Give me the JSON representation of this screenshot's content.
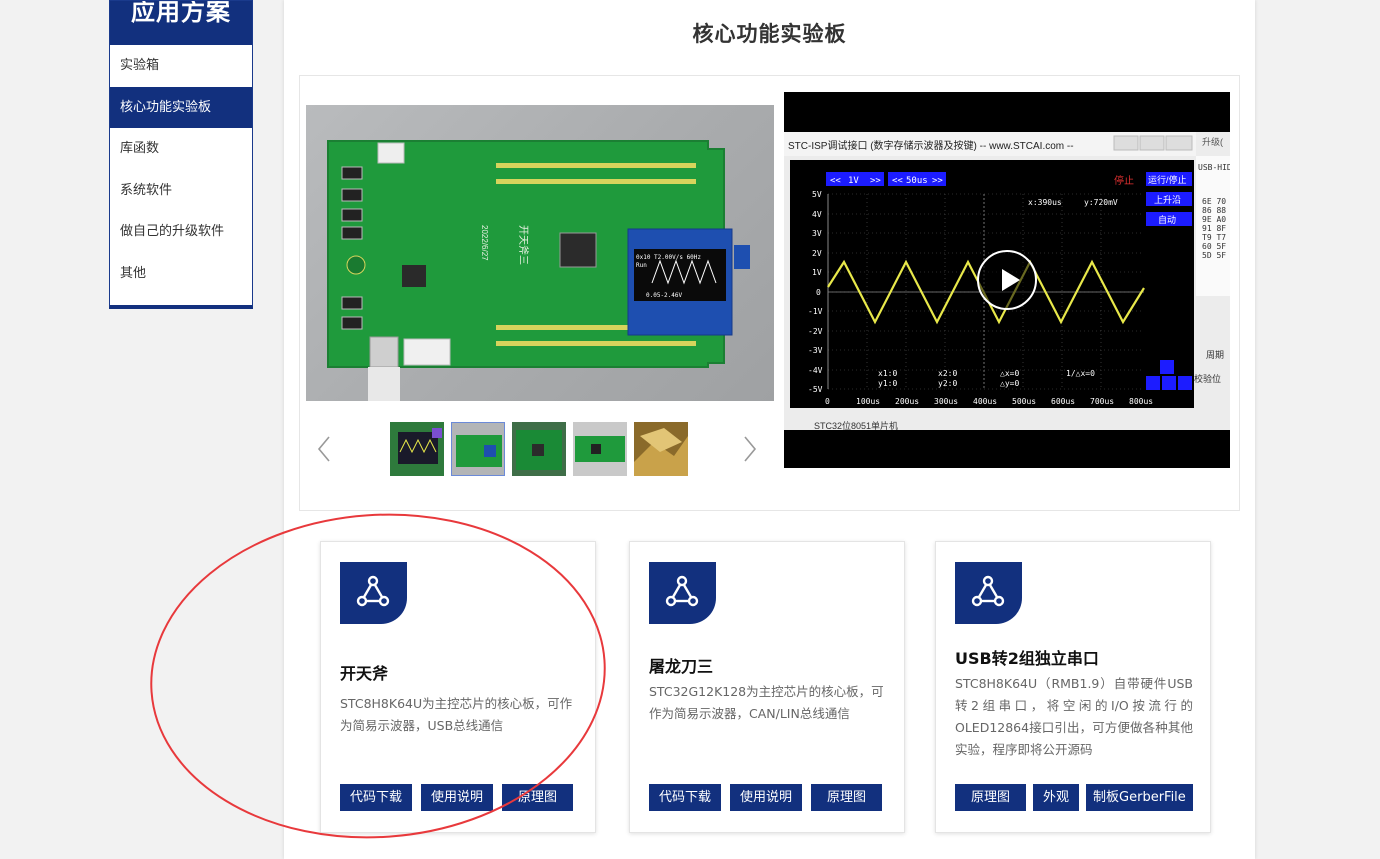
{
  "sidebar": {
    "heading": "应用方案",
    "items": [
      {
        "label": "实验箱"
      },
      {
        "label": "核心功能实验板"
      },
      {
        "label": "库函数"
      },
      {
        "label": "系统软件"
      },
      {
        "label": "做自己的升级软件"
      },
      {
        "label": "其他"
      }
    ],
    "active_index": 1
  },
  "page": {
    "title": "核心功能实验板"
  },
  "gallery": {
    "photo_text": {
      "oled_line1": "0x10 T2.00V/s 60Hz",
      "oled_line2": "Run",
      "oled_line3": "0.05-2.46V",
      "silk": "开天斧三",
      "date": "2022/6/27"
    },
    "video": {
      "window_title": "STC-ISP调试接口 (数字存储示波器及按键) -- www.STCAI.com --",
      "upgrade_tab": "升级(",
      "volt_div": "1V",
      "time_div": "50us",
      "stop_label": "停止",
      "run_stop": "运行/停止",
      "rising_edge": "上升沿",
      "auto": "自动",
      "cursor_x": "x:390us",
      "cursor_y": "y:720mV",
      "y_ticks": [
        "5V",
        "4V",
        "3V",
        "2V",
        "1V",
        "0",
        "-1V",
        "-2V",
        "-3V",
        "-4V",
        "-5V"
      ],
      "x_ticks": [
        "0",
        "100us",
        "200us",
        "300us",
        "400us",
        "500us",
        "600us",
        "700us",
        "800us"
      ],
      "readout_x1": "x1:0",
      "readout_y1": "y1:0",
      "readout_x2": "x2:0",
      "readout_y2": "y2:0",
      "readout_dx": "△x=0",
      "readout_dy": "△y=0",
      "readout_inv": "1/△x=0",
      "hex_dump": [
        "6E 70",
        "86 88",
        "9E A0",
        "91 8F",
        "T9 T7",
        "60 5F",
        "5D 5F"
      ],
      "usb_label": "USB-HID",
      "bottom_label": "STC32位8051单片机",
      "period_label": "周期",
      "checksum_label": "校验位"
    }
  },
  "cards": [
    {
      "title": "开天斧",
      "desc": "STC8H8K64U为主控芯片的核心板，可作为简易示波器，USB总线通信",
      "buttons": [
        "代码下载",
        "使用说明",
        "原理图"
      ]
    },
    {
      "title": "屠龙刀三",
      "desc": "STC32G12K128为主控芯片的核心板，可作为简易示波器，CAN/LIN总线通信",
      "buttons": [
        "代码下载",
        "使用说明",
        "原理图"
      ]
    },
    {
      "title": "USB转2组独立串口",
      "desc": "STC8H8K64U（RMB1.9）自带硬件USB转2组串口，将空闲的I/O按流行的 OLED12864接口引出，可方便做各种其他实验，程序即将公开源码",
      "buttons": [
        "原理图",
        "外观",
        "制板GerberFile"
      ]
    }
  ],
  "colors": {
    "brand_blue": "#12307e",
    "annotation_red": "#e8393c",
    "scope_wave": "#e8e84a"
  }
}
